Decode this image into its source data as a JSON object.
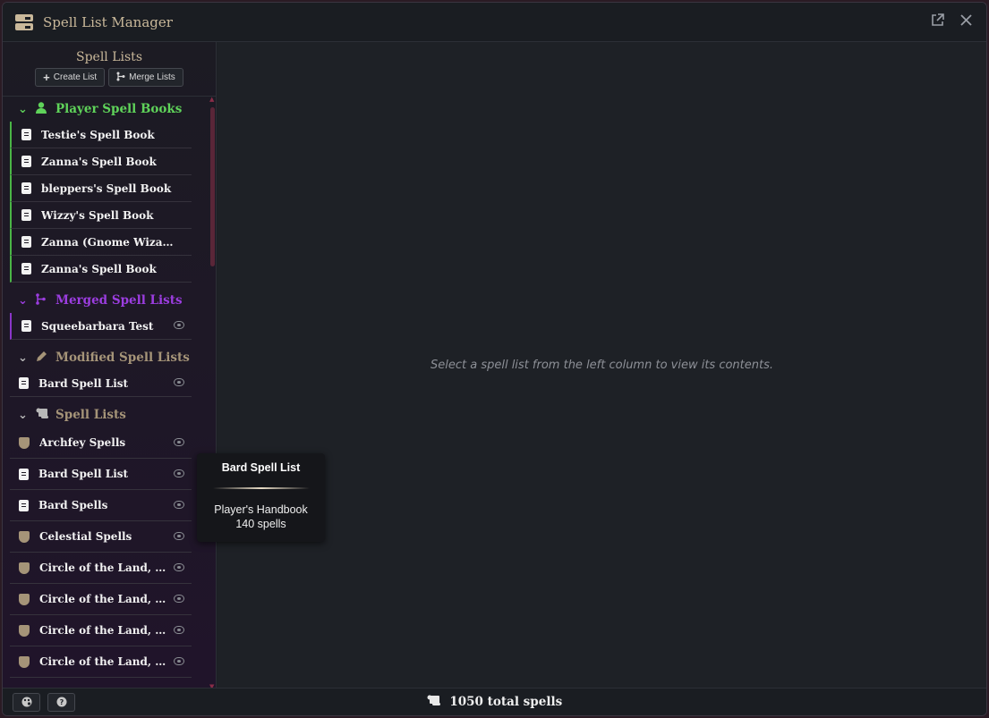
{
  "window": {
    "title": "Spell List Manager",
    "popout_icon": "external-link-icon",
    "close_icon": "close-icon"
  },
  "sidebar": {
    "title": "Spell Lists",
    "create_label": "Create List",
    "merge_label": "Merge Lists",
    "groups": {
      "player": {
        "label": "Player Spell Books",
        "color": "#5fd35a",
        "items": [
          "Testie's Spell Book",
          "Zanna's Spell Book",
          "bleppers's Spell Book",
          "Wizzy's Spell Book",
          "Zanna (Gnome Wizard)'...",
          "Zanna's Spell Book"
        ]
      },
      "merged": {
        "label": "Merged Spell Lists",
        "color": "#9c3de0",
        "items": [
          "Squeebarbara Test"
        ]
      },
      "modified": {
        "label": "Modified Spell Lists",
        "items": [
          "Bard Spell List"
        ]
      },
      "lists": {
        "label": "Spell Lists",
        "items": [
          "Archfey Spells",
          "Bard Spell List",
          "Bard Spells",
          "Celestial Spells",
          "Circle of the Land, Ar...",
          "Circle of the Land, Ar...",
          "Circle of the Land, Po...",
          "Circle of the Land, Po..."
        ]
      }
    }
  },
  "main": {
    "placeholder": "Select a spell list from the left column to view its contents."
  },
  "tooltip": {
    "title": "Bard Spell List",
    "source": "Player's Handbook",
    "count": "140 spells"
  },
  "footer": {
    "total": "1050 total spells"
  },
  "colors": {
    "accent_tan": "#c9b89a",
    "player_green": "#5fd35a",
    "merged_purple": "#9c3de0"
  }
}
